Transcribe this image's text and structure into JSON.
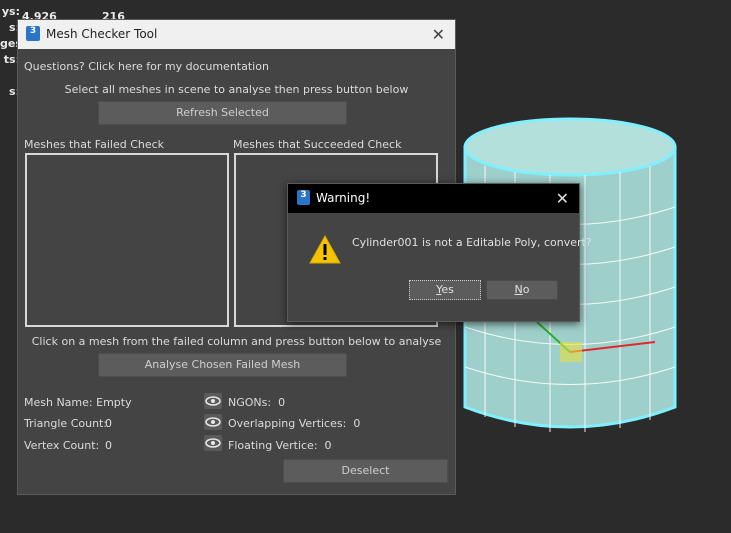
{
  "stats": {
    "rows": [
      {
        "label": "ys:",
        "v1": "4,926",
        "v2": "216"
      },
      {
        "label": "s:",
        "v1": "",
        "v2": ""
      },
      {
        "label": "ges:",
        "v1": "",
        "v2": ""
      },
      {
        "label": "ts:",
        "v1": "",
        "v2": ""
      },
      {
        "label": "",
        "v1": "",
        "v2": ""
      },
      {
        "label": "s:",
        "v1": "",
        "v2": ""
      }
    ]
  },
  "mesh_checker": {
    "title": "Mesh Checker Tool",
    "doc_link": "Questions? Click here for my documentation",
    "instruction": "Select all meshes in scene to analyse then press button below",
    "refresh_button": "Refresh Selected",
    "failed_header": "Meshes that Failed Check",
    "succeeded_header": "Meshes that Succeeded Check",
    "analyse_instruction": "Click on a mesh from the failed column and press button below to analyse",
    "analyse_button": "Analyse Chosen Failed Mesh",
    "mesh_name_label": "Mesh Name:",
    "mesh_name_value": "Empty",
    "triangle_label": "Triangle Count:",
    "triangle_value": "0",
    "vertex_label": "Vertex Count:",
    "vertex_value": "0",
    "ngons_label": "NGONs:",
    "ngons_value": "0",
    "overlap_label": "Overlapping Vertices:",
    "overlap_value": "0",
    "floating_label": "Floating Vertice:",
    "floating_value": "0",
    "deselect_button": "Deselect"
  },
  "warning": {
    "title": "Warning!",
    "message": "Cylinder001 is not a Editable Poly, convert?",
    "yes_underline": "Y",
    "yes_rest": "es",
    "no_underline": "N",
    "no_rest": "o"
  },
  "colors": {
    "accent": "#2a75c9",
    "cylinder_fill": "#a8d6d2",
    "cylinder_outline": "#7ff0ff",
    "warning_yellow": "#f5c400"
  },
  "icons": {
    "app_icon": "3dsmax-icon",
    "eye": "eye-icon",
    "warning": "warning-triangle-icon",
    "close": "close-icon"
  }
}
